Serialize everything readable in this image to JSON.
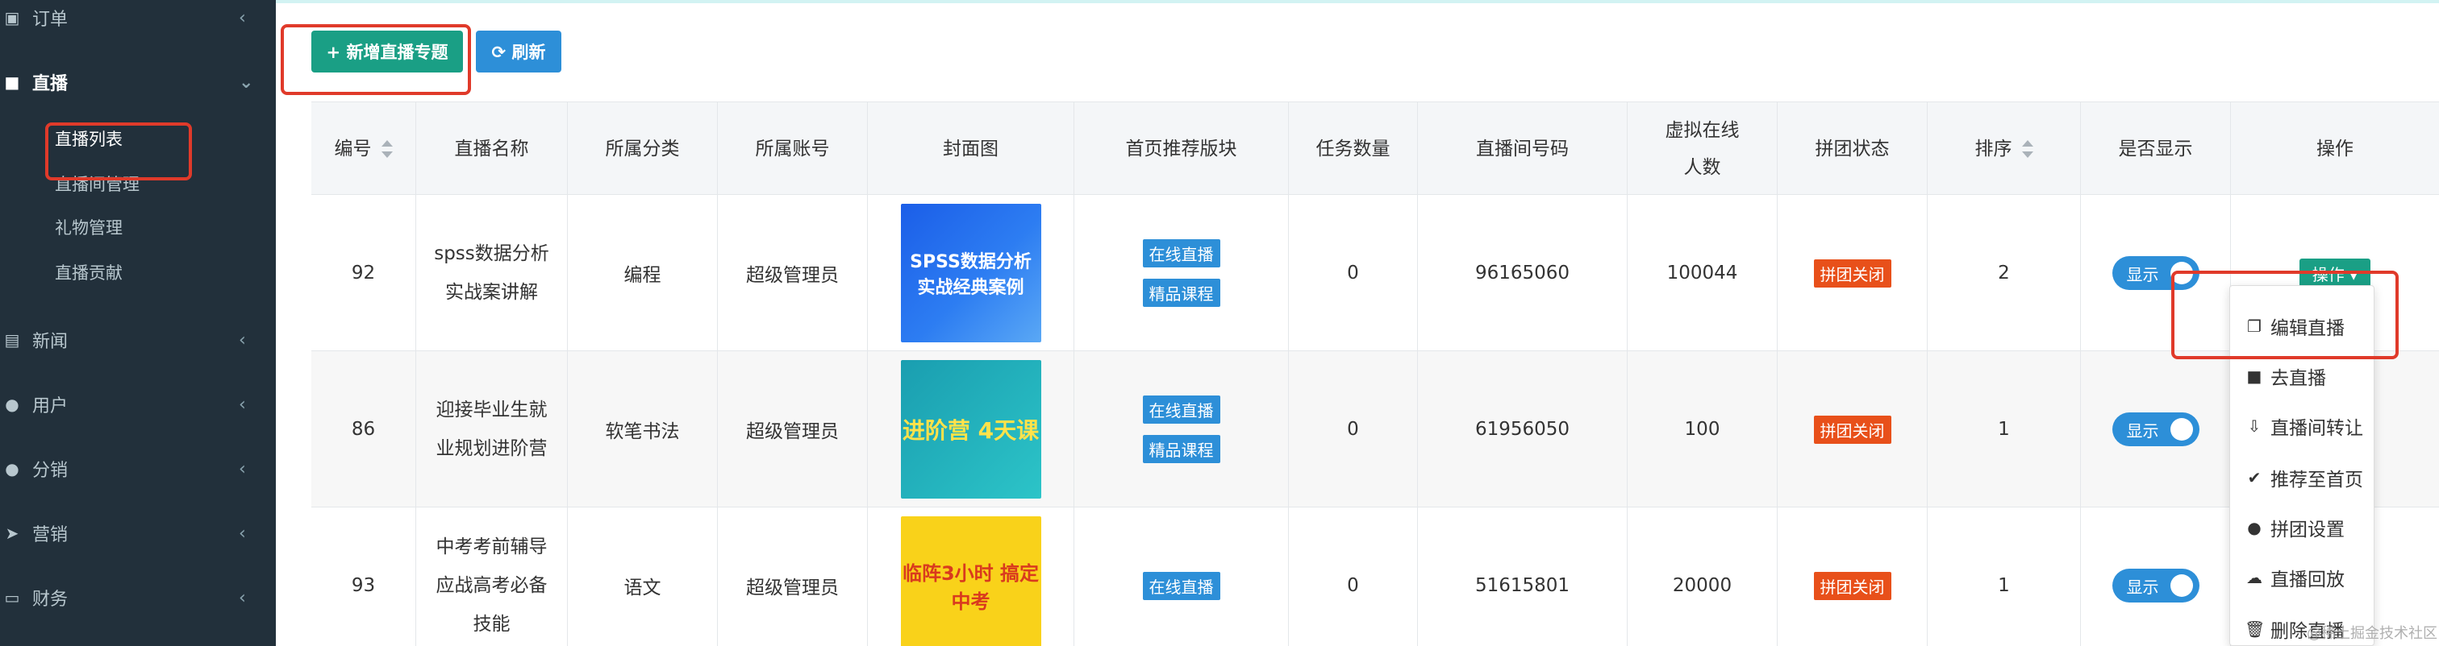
{
  "sidebar": {
    "items": [
      {
        "icon": "cart-icon",
        "label": "订单",
        "chevron": "‹"
      },
      {
        "icon": "video-icon",
        "label": "直播",
        "chevron": "⌄"
      },
      {
        "icon": "image-icon",
        "label": "新闻",
        "chevron": "‹"
      },
      {
        "icon": "user-icon",
        "label": "用户",
        "chevron": "‹"
      },
      {
        "icon": "users-icon",
        "label": "分销",
        "chevron": "‹"
      },
      {
        "icon": "paper-plane-icon",
        "label": "营销",
        "chevron": "‹"
      },
      {
        "icon": "money-icon",
        "label": "财务",
        "chevron": "‹"
      }
    ],
    "sub_items": [
      "直播列表",
      "直播间管理",
      "礼物管理",
      "直播贡献"
    ]
  },
  "toolbar": {
    "add_label": "+ 新增直播专题",
    "refresh_label": "⟳ 刷新"
  },
  "table": {
    "headers": [
      "编号",
      "直播名称",
      "所属分类",
      "所属账号",
      "封面图",
      "首页推荐版块",
      "任务数量",
      "直播间号码",
      "虚拟在线人数",
      "拼团状态",
      "排序",
      "是否显示",
      "操作"
    ],
    "rows": [
      {
        "id": "92",
        "name": "spss数据分析实战案讲解",
        "category": "编程",
        "account": "超级管理员",
        "cover_text": "SPSS数据分析 实战经典案例",
        "tags": [
          "在线直播",
          "精品课程"
        ],
        "tasks": "0",
        "room": "96165060",
        "online": "100044",
        "pin": "拼团关闭",
        "order": "2",
        "show": "显示",
        "op": "操作 ▾"
      },
      {
        "id": "86",
        "name": "迎接毕业生就业规划进阶营",
        "category": "软笔书法",
        "account": "超级管理员",
        "cover_text": "进阶营 4天课",
        "tags": [
          "在线直播",
          "精品课程"
        ],
        "tasks": "0",
        "room": "61956050",
        "online": "100",
        "pin": "拼团关闭",
        "order": "1",
        "show": "显示",
        "op": ""
      },
      {
        "id": "93",
        "name": "中考考前辅导应战高考必备技能",
        "category": "语文",
        "account": "超级管理员",
        "cover_text": "临阵3小时 搞定中考",
        "tags": [
          "在线直播"
        ],
        "tasks": "0",
        "room": "51615801",
        "online": "20000",
        "pin": "拼团关闭",
        "order": "1",
        "show": "显示",
        "op": ""
      }
    ]
  },
  "dropdown": {
    "items": [
      {
        "icon": "copy-icon",
        "label": "编辑直播"
      },
      {
        "icon": "video-icon",
        "label": "去直播"
      },
      {
        "icon": "transfer-icon",
        "label": "直播间转让"
      },
      {
        "icon": "check-circle-icon",
        "label": "推荐至首页"
      },
      {
        "icon": "group-icon",
        "label": "拼团设置"
      },
      {
        "icon": "cloud-download-icon",
        "label": "直播回放"
      },
      {
        "icon": "trash-icon",
        "label": "删除直播"
      }
    ]
  },
  "watermark": "@稀土掘金技术社区",
  "colors": {
    "sidebar_bg": "#22303b",
    "primary_green": "#1a9f85",
    "primary_blue": "#2d8fd8",
    "tag_red": "#e8501a",
    "highlight_red": "#e03a2a"
  }
}
